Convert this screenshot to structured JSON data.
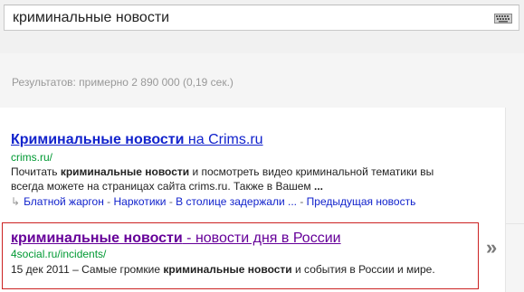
{
  "search": {
    "query": "криминальные новости",
    "keyboard_icon": "keyboard-icon"
  },
  "stats": {
    "text": "Результатов: примерно 2 890 000 (0,19 сек.)"
  },
  "results": [
    {
      "title_bold": "Криминальные новости",
      "title_rest": " на Crims.ru",
      "url": "crims.ru/",
      "snippet": [
        {
          "pre": "Почитать ",
          "bold": "криминальные новости",
          "post": " и посмотреть видео криминальной тематики вы"
        },
        {
          "pre": "всегда можете на страницах сайта crims.ru. Также в Вашем ",
          "bold": "...",
          "post": ""
        }
      ],
      "sitelinks": [
        "Блатной жаргон",
        "Наркотики",
        "В столице задержали ...",
        "Предыдущая новость"
      ],
      "sitelink_sep": " - "
    },
    {
      "title_bold": "криминальные новости",
      "title_rest": " - новости дня в России",
      "url": "4social.ru/incidents/",
      "snippet": [
        {
          "pre": "15 дек 2011 – Самые громкие ",
          "bold": "криминальные новости",
          "post": " и события в России и мире."
        }
      ]
    }
  ],
  "right_gutter": {
    "chevron": "»",
    "chevron_icon": "double-chevron-right-icon"
  },
  "colors": {
    "link": "#1122cc",
    "visited": "#660099",
    "url": "#009933",
    "highlight": "#cc2222"
  }
}
